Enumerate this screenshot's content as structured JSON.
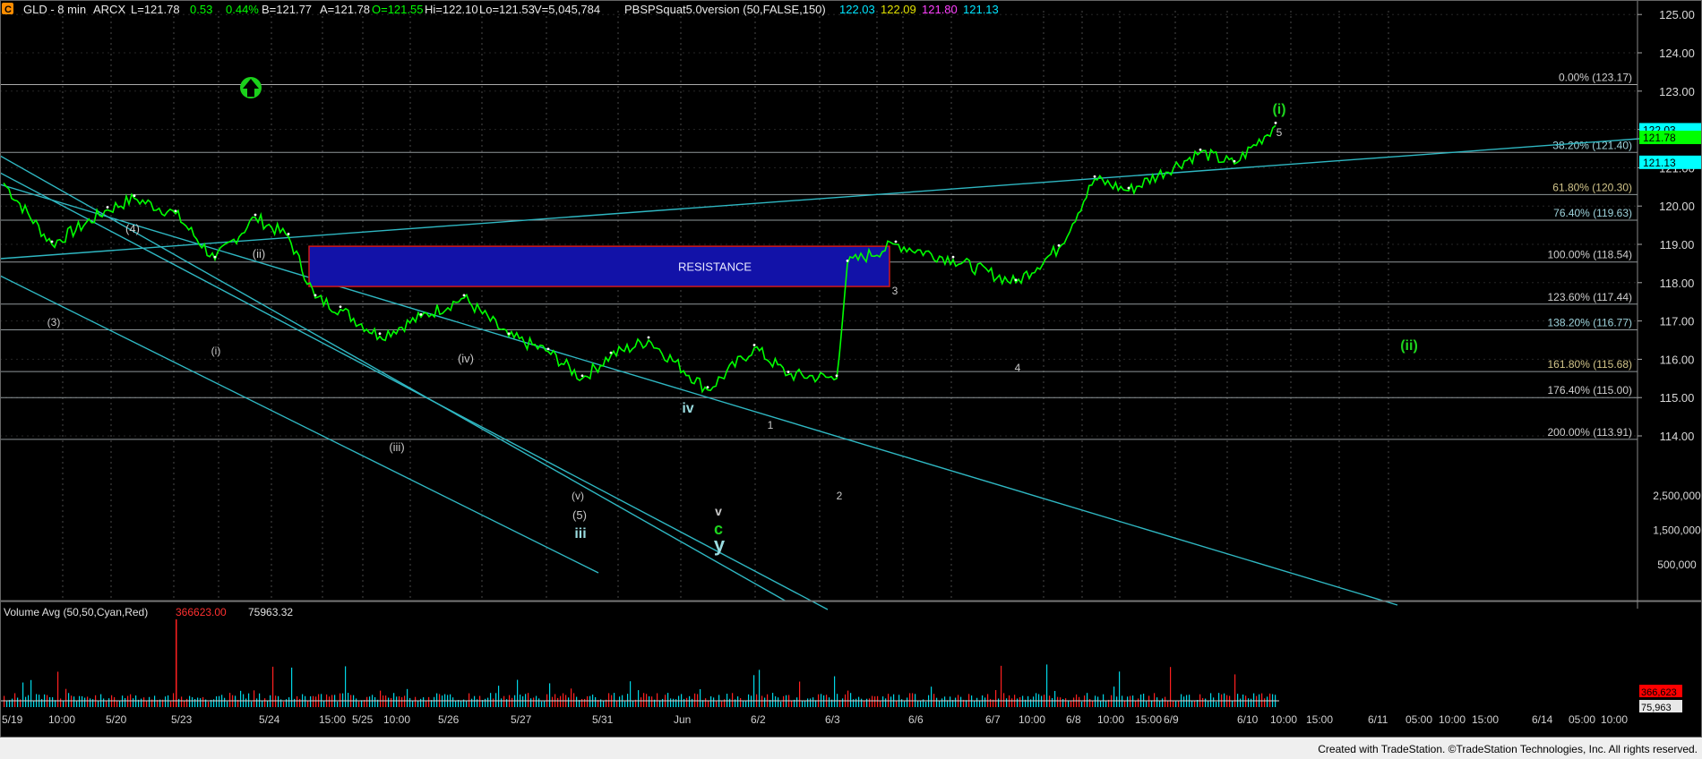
{
  "colors": {
    "background": "#000000",
    "grid": "#4a4a4a",
    "trend": "#2fb7c2",
    "fib": "#a9b2b5",
    "price": "#00ff00",
    "resistance_fill": "#1212a8",
    "resistance_border": "#d01818",
    "green_label": "#1ed51e",
    "cyan_label": "#00e5ff",
    "white_text": "#dcdcdc",
    "up_arrow": "#1bd11b"
  },
  "header": {
    "icon_letter": "C",
    "symbol": "GLD - 8 min",
    "exchange": "ARCX",
    "last": "L=121.78",
    "change": "0.53",
    "change_pct": "0.44%",
    "bid": "B=121.77",
    "ask": "A=121.78",
    "open": "O=121.55",
    "high": "Hi=122.10",
    "low": "Lo=121.53",
    "volume": "V=5,045,784",
    "indicator_name": "PBSPSquat5.0version (50,FALSE,150)",
    "ind_v1": "122.03",
    "ind_v2": "122.09",
    "ind_v3": "121.80",
    "ind_v4": "121.13"
  },
  "price_axis": {
    "ticks": [
      "125.00",
      "124.00",
      "123.00",
      "122.00",
      "121.00",
      "120.00",
      "119.00",
      "118.00",
      "117.00",
      "116.00",
      "115.00",
      "114.00"
    ],
    "tags": [
      {
        "value": "122.03",
        "bg": "#00ffff",
        "fg": "#000000",
        "y": 121.98
      },
      {
        "value": "121.78",
        "bg": "#00ff00",
        "fg": "#000000",
        "y": 121.78
      },
      {
        "value": "121.13",
        "bg": "#00ffff",
        "fg": "#000000",
        "y": 121.13
      }
    ]
  },
  "volume_axis": {
    "ticks": [
      "2,500,000",
      "1,500,000",
      "500,000"
    ],
    "tags": [
      {
        "value": "366,623",
        "bg": "#ff0000",
        "fg": "#000000"
      },
      {
        "value": "75,963",
        "bg": "#e8e8e8",
        "fg": "#000000"
      }
    ]
  },
  "volume_panel": {
    "title": "Volume Avg (50,50,Cyan,Red)",
    "val_red": "366623.00",
    "val_white": "75963.32"
  },
  "time_axis": {
    "labels": [
      "5/19",
      "10:00",
      "5/20",
      "5/23",
      "5/24",
      "15:00",
      "5/25",
      "10:00",
      "5/26",
      "5/27",
      "5/31",
      "Jun",
      "6/2",
      "6/3",
      "6/6",
      "6/7",
      "10:00",
      "6/8",
      "10:00",
      "15:00",
      "6/9",
      "6/10",
      "10:00",
      "15:00",
      "6/11",
      "05:00",
      "10:00",
      "15:00",
      "6/14",
      "05:00",
      "10:00"
    ]
  },
  "fib_levels": [
    {
      "label": "0.00%",
      "value": "123.17"
    },
    {
      "label": "38.20%",
      "value": "121.40"
    },
    {
      "label": "61.80%",
      "value": "120.30"
    },
    {
      "label": "76.40%",
      "value": "119.63"
    },
    {
      "label": "100.00%",
      "value": "118.54"
    },
    {
      "label": "123.60%",
      "value": "117.44"
    },
    {
      "label": "138.20%",
      "value": "116.77"
    },
    {
      "label": "161.80%",
      "value": "115.68"
    },
    {
      "label": "176.40%",
      "value": "115.00"
    },
    {
      "label": "200.00%",
      "value": "113.91"
    }
  ],
  "annotations": {
    "resistance": "RESISTANCE",
    "wave_labels": [
      "(4)",
      "(ii)",
      "(3)",
      "(i)",
      "(iv)",
      "(iii)",
      "(v)",
      "(5)",
      "iii",
      "iv",
      "v",
      "c",
      "y",
      "1",
      "2",
      "3",
      "4",
      "5",
      "(i)",
      "(ii)"
    ]
  },
  "footer": {
    "credit": "Created with TradeStation. ©TradeStation Technologies, Inc. All rights reserved."
  },
  "chart_data": {
    "type": "line",
    "title": "GLD - 8 min",
    "ylim": [
      113.0,
      125.3
    ],
    "x": [
      "5/19",
      "5/19 10:00",
      "5/20",
      "5/20 b",
      "5/23",
      "5/23 b",
      "5/24",
      "5/24 b",
      "5/24 15:00",
      "5/25",
      "5/25 10:00",
      "5/26",
      "5/26 b",
      "5/27",
      "5/27 b",
      "5/31",
      "5/31 b",
      "Jun",
      "Jun b",
      "6/2",
      "6/2 b",
      "6/3",
      "6/3 b",
      "6/6",
      "6/6 b",
      "6/7",
      "6/7 b",
      "6/8",
      "6/8 b",
      "6/9",
      "6/9 b",
      "6/10 10:00"
    ],
    "series": [
      {
        "values": [
          120.6,
          119.0,
          119.9,
          120.2,
          119.8,
          118.6,
          119.7,
          119.2,
          117.6,
          117.3,
          116.6,
          117.1,
          117.6,
          116.6,
          116.2,
          115.5,
          116.1,
          116.5,
          115.2,
          116.3,
          115.6,
          115.5,
          118.5,
          119.0,
          118.6,
          118.0,
          118.9,
          120.7,
          120.4,
          121.4,
          121.1,
          122.1
        ]
      }
    ],
    "resistance_box": {
      "label": "RESISTANCE",
      "y_range": [
        117.9,
        118.95
      ]
    },
    "fib_levels": [
      123.17,
      121.4,
      120.3,
      119.63,
      118.54,
      117.44,
      116.77,
      115.68,
      115.0,
      113.91
    ],
    "volume_ylim": [
      0,
      3000000
    ]
  }
}
